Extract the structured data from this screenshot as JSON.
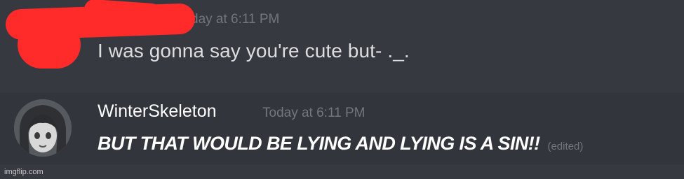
{
  "messages": [
    {
      "timestamp": "day at 6:11 PM",
      "text": "I was gonna say you're cute but- ._.",
      "redacted": true
    },
    {
      "author": "WinterSkeleton",
      "timestamp": "Today at 6:11 PM",
      "text": "BUT THAT WOULD BE LYING AND LYING IS A SIN!!",
      "edited_label": "(edited)"
    }
  ],
  "watermark": "imgflip.com",
  "colors": {
    "background": "#36393f",
    "highlight_row": "#32353b",
    "redaction": "#ff2a2a",
    "muted_text": "#72767d",
    "message_text": "#dcddde"
  }
}
